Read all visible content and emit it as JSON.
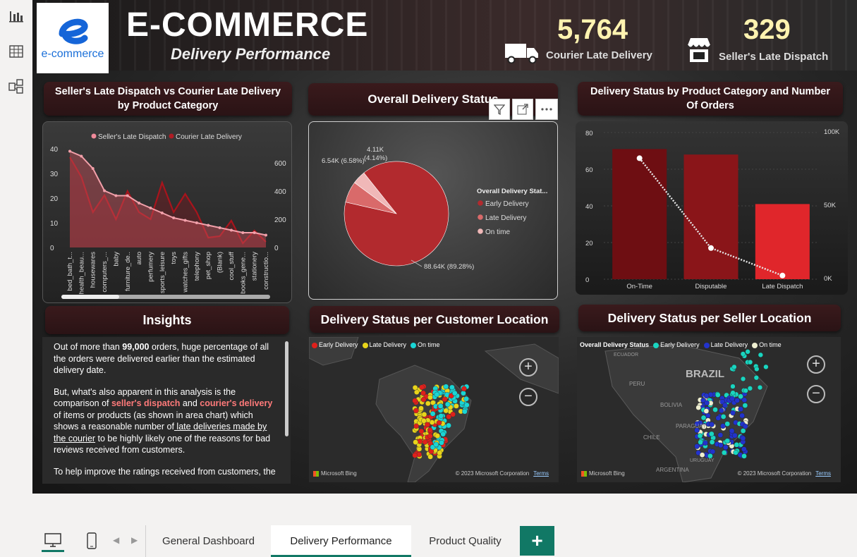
{
  "header": {
    "logo_text": "e-commerce",
    "title": "E-COMMERCE",
    "subtitle": "Delivery Performance"
  },
  "kpis": [
    {
      "value": "5,764",
      "label": "Courier Late Delivery"
    },
    {
      "value": "329",
      "label": "Seller's Late Dispatch"
    }
  ],
  "panels": {
    "area_title": "Seller's Late Dispatch vs Courier Late Delivery by Product Category",
    "pie_title": "Overall Delivery Status",
    "bar_title": "Delivery Status by Product Category and Number Of Orders",
    "insights_title": "Insights",
    "customer_map_title": "Delivery Status per Customer Location",
    "seller_map_title": "Delivery Status per Seller Location"
  },
  "insights": {
    "p1_a": "Out of more than ",
    "p1_b": "99,000",
    "p1_c": " orders, huge percentage of all the orders were delivered earlier than the estimated delivery date.",
    "p2_a": " But, what's also apparent in this analysis is the comparison of ",
    "p2_b": "seller's dispatch",
    "p2_c": " and ",
    "p2_d": "courier's delivery",
    "p2_e": " of items or products (as shown in area chart) which shows a reasonable number of",
    "p2_f": " late deliveries made by the courier",
    "p2_g": " to be highly likely one of the reasons for bad reviews received from customers.",
    "p3": "To help improve the ratings received from customers, the"
  },
  "maps": {
    "customer_legend": [
      "Early Delivery",
      "Late Delivery",
      "On time"
    ],
    "seller_legend_title": "Overall Delivery Status",
    "seller_legend": [
      "Early Delivery",
      "Late Delivery",
      "On time"
    ],
    "labels": [
      "BRAZIL",
      "PERU",
      "BOLIVIA",
      "PARAGUAY",
      "CHILE",
      "ARGENTINA",
      "ECUADOR",
      "URUGUAY"
    ],
    "copyright": "© 2023 Microsoft Corporation",
    "terms": "Terms",
    "bing": "Microsoft Bing",
    "zoom_in": "+",
    "zoom_out": "−"
  },
  "tabs": [
    "General Dashboard",
    "Delivery Performance",
    "Product Quality"
  ],
  "add_tab": "+",
  "colors": {
    "accent": "#117865",
    "early": "#b22a2e",
    "late": "#d96a6a",
    "ontime": "#f0b8b8",
    "kpi": "#fff3b0"
  },
  "chart_data": [
    {
      "type": "area",
      "legend": [
        "Seller's Late Dispatch",
        "Courier Late Delivery"
      ],
      "categories": [
        "bed_bath_t...",
        "health_beau...",
        "housewares",
        "computers_...",
        "baby",
        "furniture_de...",
        "auto",
        "perfumery",
        "sports_leisure",
        "toys",
        "watches_gifts",
        "telephony",
        "pet_shop",
        "(Blank)",
        "cool_stuff",
        "books_gene...",
        "stationery",
        "constructio..."
      ],
      "series": [
        {
          "name": "Seller's Late Dispatch",
          "axis": "left",
          "values": [
            39,
            37,
            32,
            23,
            21,
            21,
            18,
            16,
            14,
            12,
            11,
            10,
            9,
            8,
            7,
            6,
            6,
            5
          ]
        },
        {
          "name": "Courier Late Delivery",
          "axis": "right",
          "values": [
            640,
            500,
            250,
            370,
            200,
            400,
            250,
            200,
            460,
            250,
            380,
            250,
            70,
            80,
            190,
            30,
            120,
            40
          ]
        }
      ],
      "y_left_ticks": [
        0,
        10,
        20,
        30,
        40
      ],
      "y_right_ticks": [
        0,
        200,
        400,
        600
      ]
    },
    {
      "type": "pie",
      "legend_title": "Overall Delivery Stat...",
      "slices": [
        {
          "name": "Early Delivery",
          "value": 88.64,
          "label": "88.64K (89.28%)"
        },
        {
          "name": "Late Delivery",
          "value": 6.54,
          "label": "6.54K (6.58%)"
        },
        {
          "name": "On time",
          "value": 4.11,
          "label_a": "4.11K",
          "label_b": "(4.14%)"
        }
      ]
    },
    {
      "type": "bar",
      "categories": [
        "On-Time",
        "Disputable",
        "Late Dispatch"
      ],
      "bar_values": [
        71,
        68,
        41
      ],
      "line_values": [
        66,
        17,
        2
      ],
      "y_left_ticks": [
        0,
        20,
        40,
        60,
        80
      ],
      "y_right_ticks": [
        "0K",
        "50K",
        "100K"
      ],
      "ylim": [
        0,
        80
      ]
    }
  ]
}
